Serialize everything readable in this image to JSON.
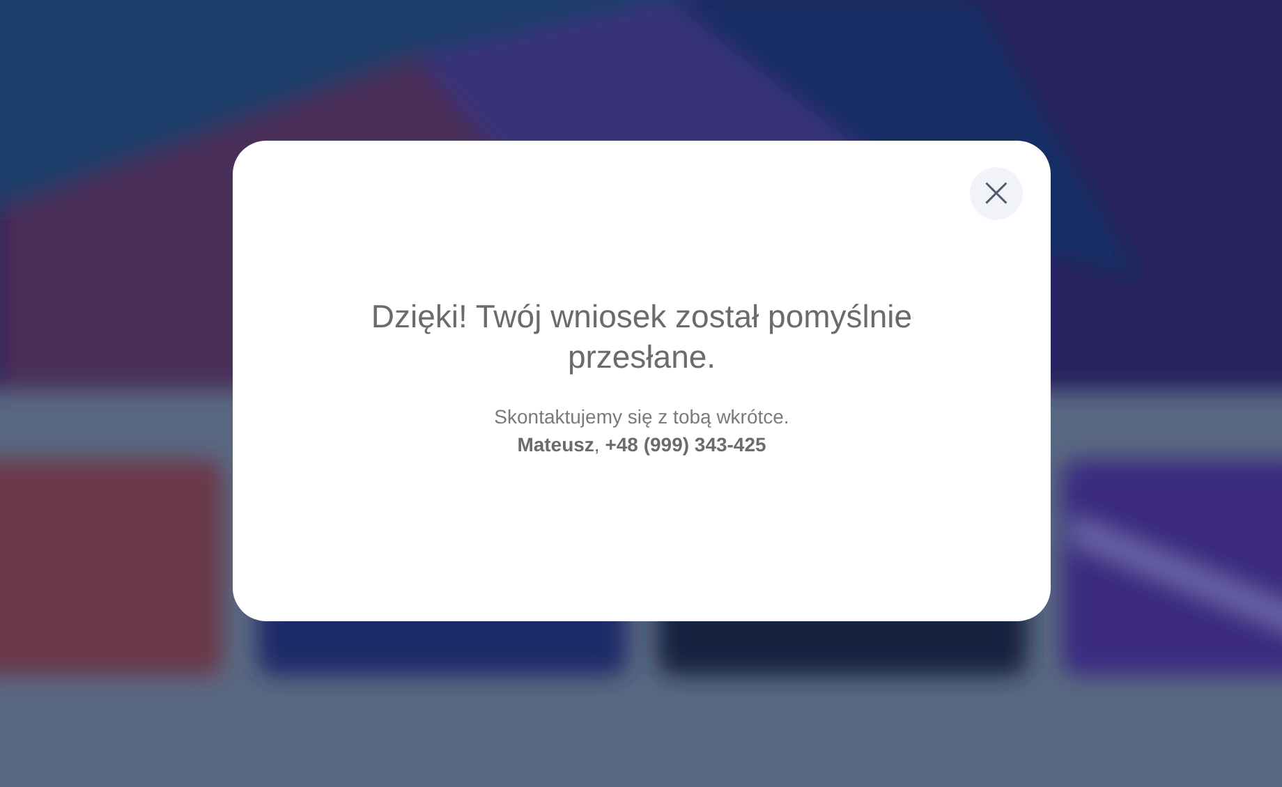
{
  "dialog": {
    "close_label": "×",
    "title": "Dzięki! Twój wniosek został pomyślnie przesłane.",
    "message": "Skontaktujemy się z tobą wkrótce.",
    "contact": "**Mateusz**, **+48 (999) 343-425**"
  }
}
